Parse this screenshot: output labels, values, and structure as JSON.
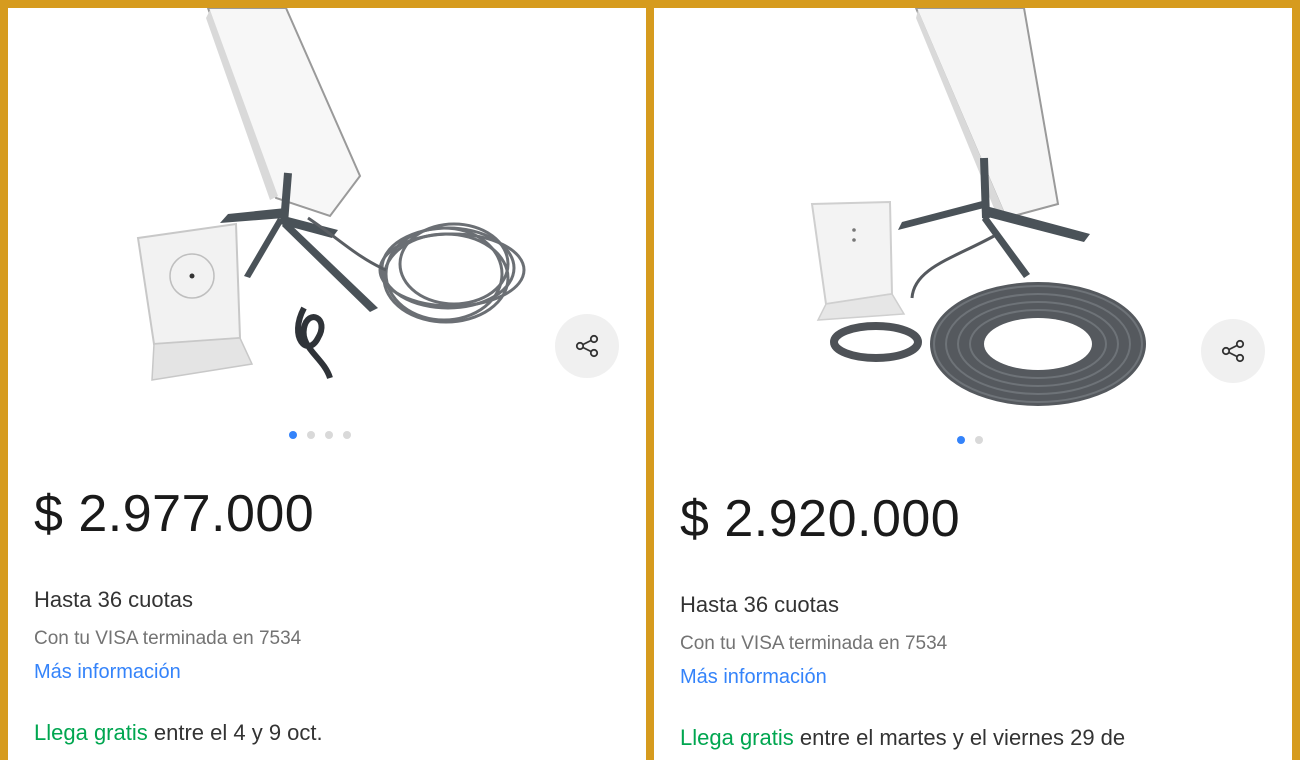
{
  "colors": {
    "frame": "#d69b1e",
    "free_shipping": "#00a650",
    "link": "#3483fa",
    "dot_active": "#3483fa",
    "dot_inactive": "#d9d9d9"
  },
  "listings": [
    {
      "image_alt": "Starlink antenna kit with router and cables",
      "carousel": {
        "total": 4,
        "active_index": 0
      },
      "price": "$ 2.977.000",
      "installments": "Hasta 36 cuotas",
      "card_note": "Con tu VISA terminada en 7534",
      "more_info": "Más información",
      "shipping_highlight": "Llega gratis",
      "shipping_rest": " entre el 4 y 9 oct.",
      "share_icon": "share-icon"
    },
    {
      "image_alt": "Starlink antenna kit with router and coiled cable",
      "carousel": {
        "total": 2,
        "active_index": 0
      },
      "price": "$ 2.920.000",
      "installments": "Hasta 36 cuotas",
      "card_note": "Con tu VISA terminada en 7534",
      "more_info": "Más información",
      "shipping_highlight": "Llega gratis",
      "shipping_rest": " entre el martes y el viernes 29 de",
      "share_icon": "share-icon"
    }
  ]
}
